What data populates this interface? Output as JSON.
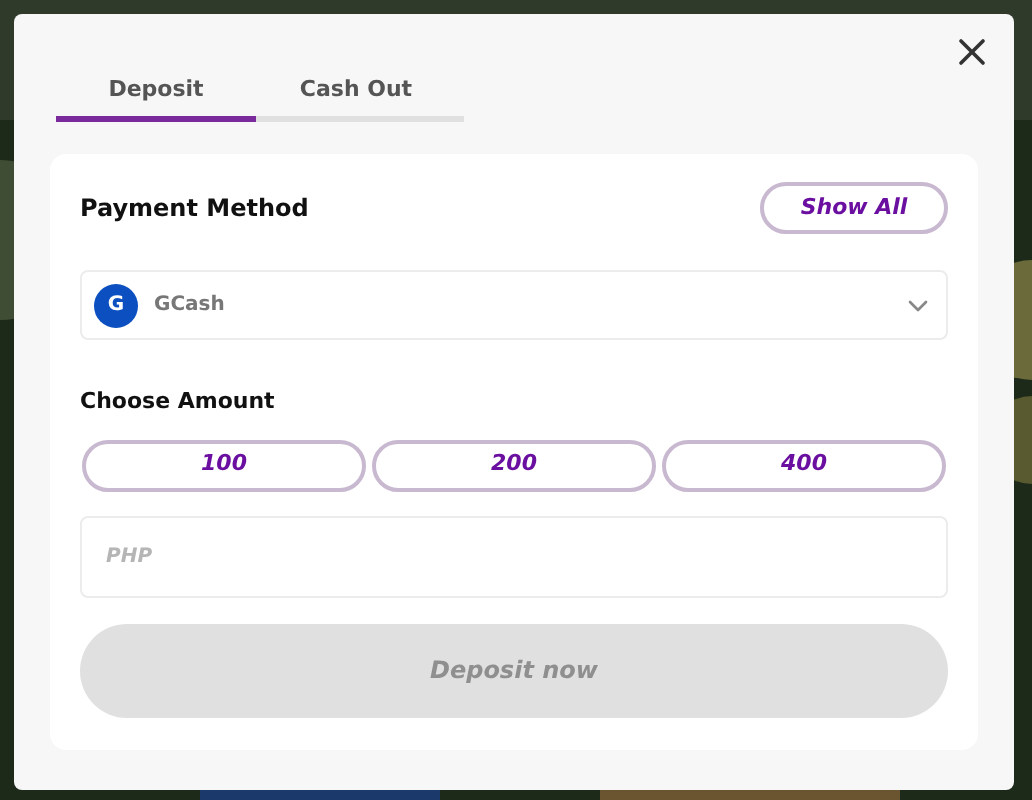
{
  "tabs": [
    {
      "label": "Deposit",
      "selected": true
    },
    {
      "label": "Cash Out",
      "selected": false
    }
  ],
  "payment_method": {
    "label": "Payment Method",
    "show_all": "Show All",
    "selected_method": "GCash",
    "logo_text": "G"
  },
  "amount": {
    "label": "Choose Amount",
    "presets": [
      "100",
      "200",
      "400"
    ],
    "placeholder": "PHP"
  },
  "submit": {
    "label": "Deposit now",
    "disabled": true
  }
}
